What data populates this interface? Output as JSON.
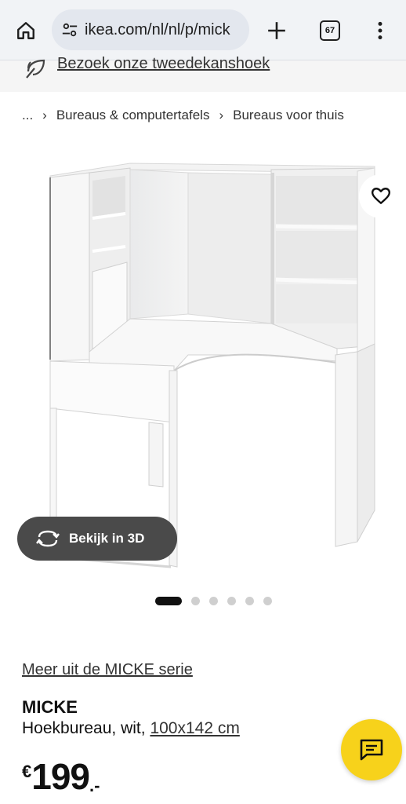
{
  "browser": {
    "url": "ikea.com/nl/nl/p/mick",
    "tab_count": "67"
  },
  "banner": {
    "link_text": "Bezoek onze tweedekanshoek"
  },
  "breadcrumb": {
    "ellipsis": "...",
    "items": [
      "Bureaus & computertafels",
      "Bureaus voor thuis"
    ]
  },
  "gallery": {
    "view3d_label": "Bekijk in 3D",
    "image_count": 6,
    "active_index": 0
  },
  "product": {
    "series_link": "Meer uit de MICKE serie",
    "name": "MICKE",
    "description": "Hoekbureau, wit,",
    "dimensions": "100x142 cm",
    "price_currency": "€",
    "price_amount": "199",
    "price_suffix": ".-"
  },
  "colors": {
    "chat_button": "#f7d21b",
    "view3d_button": "#4a4a4a"
  },
  "icons": {
    "home": "home-icon",
    "site_info": "tune-icon",
    "new_tab": "plus-icon",
    "menu": "more-vertical-icon",
    "banner": "second-chance-icon",
    "favorite": "heart-icon",
    "view3d": "rotate-3d-icon",
    "chat": "chat-icon"
  }
}
